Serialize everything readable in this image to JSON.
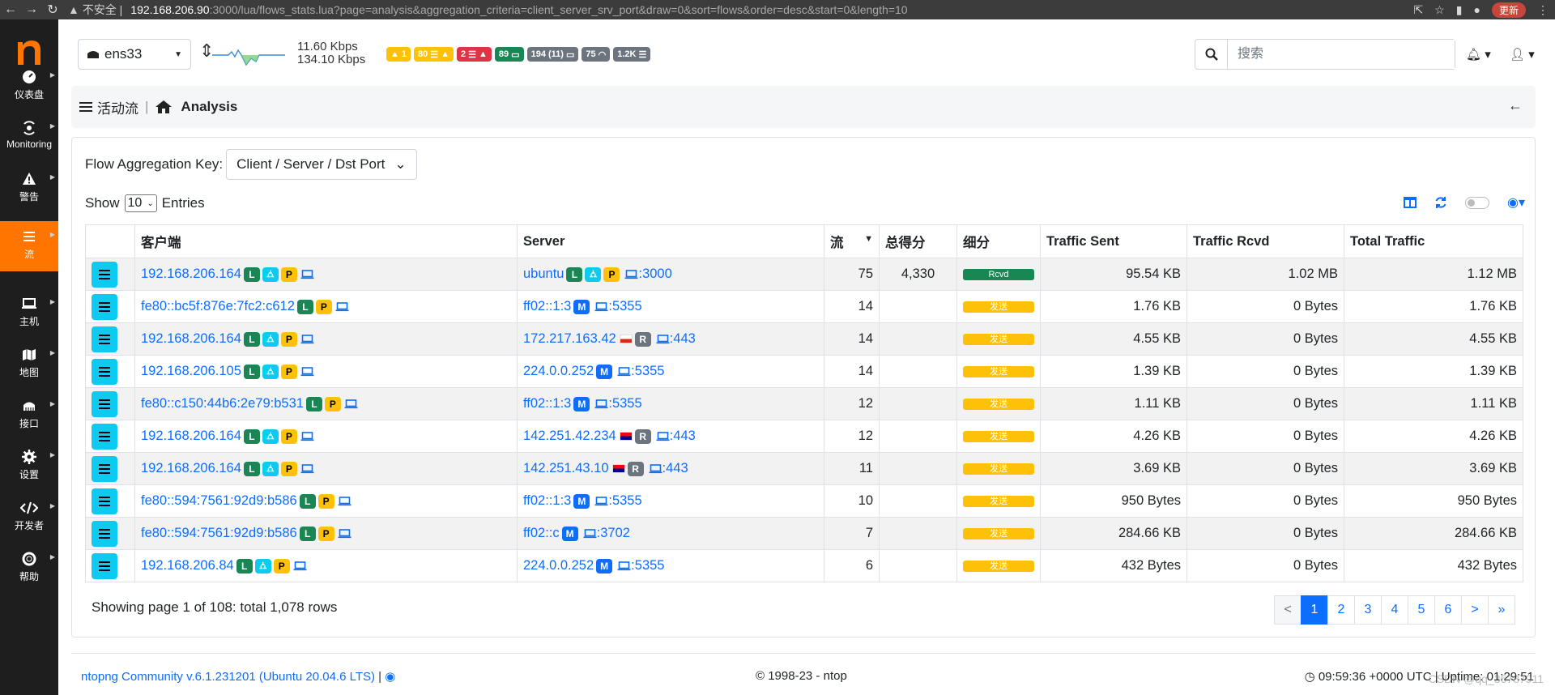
{
  "browser": {
    "security_label": "不安全",
    "url_host": "192.168.206.90",
    "url_rest": ":3000/lua/flows_stats.lua?page=analysis&aggregation_criteria=client_server_srv_port&draw=0&sort=flows&order=desc&start=0&length=10",
    "update_label": "更新"
  },
  "sidebar": {
    "items": [
      {
        "label": "仪表盘",
        "icon": "gauge-icon"
      },
      {
        "label": "Monitoring",
        "icon": "monitoring-icon"
      },
      {
        "label": "警告",
        "icon": "warning-icon"
      },
      {
        "label": "流",
        "icon": "flows-icon"
      },
      {
        "label": "主机",
        "icon": "laptop-icon"
      },
      {
        "label": "地图",
        "icon": "map-icon"
      },
      {
        "label": "接口",
        "icon": "ethernet-icon"
      },
      {
        "label": "设置",
        "icon": "gear-icon"
      },
      {
        "label": "开发者",
        "icon": "code-icon"
      },
      {
        "label": "帮助",
        "icon": "lifebuoy-icon"
      }
    ],
    "active_index": 3
  },
  "topbar": {
    "interface": "ens33",
    "throughput_up": "11.60 Kbps",
    "throughput_down": "134.10 Kbps",
    "badges": {
      "b0": "1",
      "b1": "80",
      "b2": "2",
      "b3": "89",
      "b4": "194 (11)",
      "b5": "75",
      "b6": "1.2K"
    },
    "search_placeholder": "搜索"
  },
  "breadcrumb": {
    "section": "活动流",
    "page": "Analysis"
  },
  "card": {
    "agg_label": "Flow Aggregation Key:",
    "agg_value": "Client / Server / Dst Port",
    "show_label": "Show",
    "show_value": "10",
    "entries_label": "Entries"
  },
  "table": {
    "headers": [
      "客户端",
      "Server",
      "流",
      "总得分",
      "细分",
      "Traffic Sent",
      "Traffic Rcvd",
      "Total Traffic"
    ],
    "rows": [
      {
        "client": "192.168.206.164",
        "server": "ubuntu",
        "port": "3000",
        "flows": "75",
        "score": "4,330",
        "breakdown": "Rcvd",
        "sent": "95.54 KB",
        "rcvd": "1.02 MB",
        "total": "1.12 MB"
      },
      {
        "client": "fe80::bc5f:876e:7fc2:c612",
        "server": "ff02::1:3",
        "port": "5355",
        "flows": "14",
        "score": "",
        "breakdown": "发送",
        "sent": "1.76 KB",
        "rcvd": "0 Bytes",
        "total": "1.76 KB"
      },
      {
        "client": "192.168.206.164",
        "server": "172.217.163.42",
        "port": "443",
        "flows": "14",
        "score": "",
        "breakdown": "发送",
        "sent": "4.55 KB",
        "rcvd": "0 Bytes",
        "total": "4.55 KB"
      },
      {
        "client": "192.168.206.105",
        "server": "224.0.0.252",
        "port": "5355",
        "flows": "14",
        "score": "",
        "breakdown": "发送",
        "sent": "1.39 KB",
        "rcvd": "0 Bytes",
        "total": "1.39 KB"
      },
      {
        "client": "fe80::c150:44b6:2e79:b531",
        "server": "ff02::1:3",
        "port": "5355",
        "flows": "12",
        "score": "",
        "breakdown": "发送",
        "sent": "1.11 KB",
        "rcvd": "0 Bytes",
        "total": "1.11 KB"
      },
      {
        "client": "192.168.206.164",
        "server": "142.251.42.234",
        "port": "443",
        "flows": "12",
        "score": "",
        "breakdown": "发送",
        "sent": "4.26 KB",
        "rcvd": "0 Bytes",
        "total": "4.26 KB"
      },
      {
        "client": "192.168.206.164",
        "server": "142.251.43.10",
        "port": "443",
        "flows": "11",
        "score": "",
        "breakdown": "发送",
        "sent": "3.69 KB",
        "rcvd": "0 Bytes",
        "total": "3.69 KB"
      },
      {
        "client": "fe80::594:7561:92d9:b586",
        "server": "ff02::1:3",
        "port": "5355",
        "flows": "10",
        "score": "",
        "breakdown": "发送",
        "sent": "950 Bytes",
        "rcvd": "0 Bytes",
        "total": "950 Bytes"
      },
      {
        "client": "fe80::594:7561:92d9:b586",
        "server": "ff02::c",
        "port": "3702",
        "flows": "7",
        "score": "",
        "breakdown": "发送",
        "sent": "284.66 KB",
        "rcvd": "0 Bytes",
        "total": "284.66 KB"
      },
      {
        "client": "192.168.206.84",
        "server": "224.0.0.252",
        "port": "5355",
        "flows": "6",
        "score": "",
        "breakdown": "发送",
        "sent": "432 Bytes",
        "rcvd": "0 Bytes",
        "total": "432 Bytes"
      }
    ]
  },
  "pagination": {
    "info": "Showing page 1 of 108: total 1,078 rows",
    "prev": "<",
    "pages": [
      "1",
      "2",
      "3",
      "4",
      "5",
      "6"
    ],
    "next": ">",
    "last": "»"
  },
  "footer": {
    "version": "ntopng Community v.6.1.231201 (Ubuntu 20.04.6 LTS)",
    "separator": "|",
    "copyright": "© 1998-23 - ntop",
    "time_uptime": "09:59:36 +0000 UTC | Uptime: 01:29:51",
    "watermark": "CSDN @qq_36787911"
  },
  "colors": {
    "brand_orange": "#ff7500",
    "link_blue": "#0d6efd",
    "info_cyan": "#0dcaf0",
    "success_green": "#198754",
    "warning_yellow": "#ffc107",
    "danger_red": "#dc3545"
  }
}
